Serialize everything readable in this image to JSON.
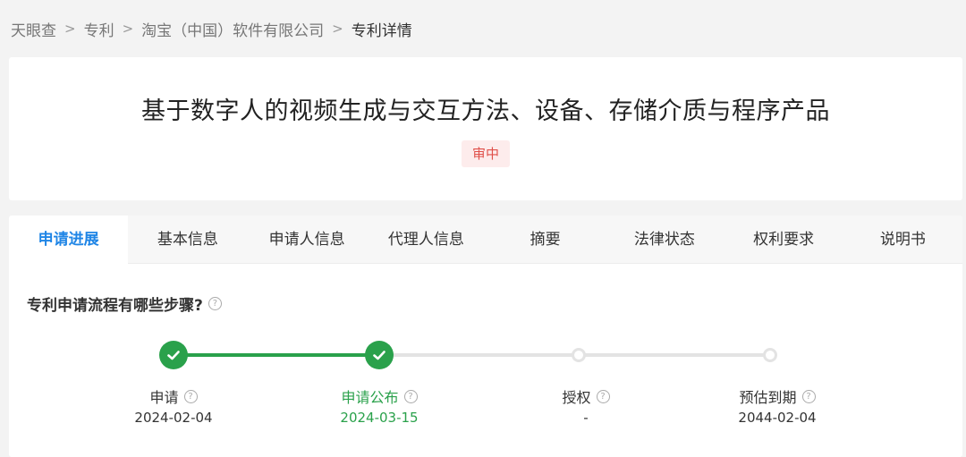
{
  "breadcrumb": {
    "items": [
      "天眼查",
      "专利",
      "淘宝（中国）软件有限公司",
      "专利详情"
    ],
    "separator": ">"
  },
  "patent": {
    "title": "基于数字人的视频生成与交互方法、设备、存储介质与程序产品",
    "status": "审中"
  },
  "tabs": [
    "申请进展",
    "基本信息",
    "申请人信息",
    "代理人信息",
    "摘要",
    "法律状态",
    "权利要求",
    "说明书"
  ],
  "active_tab": "申请进展",
  "progress": {
    "heading": "专利申请流程有哪些步骤?",
    "help_glyph": "?",
    "steps": [
      {
        "label": "申请",
        "date": "2024-02-04",
        "status": "done"
      },
      {
        "label": "申请公布",
        "date": "2024-03-15",
        "status": "done"
      },
      {
        "label": "授权",
        "date": "-",
        "status": "pending"
      },
      {
        "label": "预估到期",
        "date": "2044-02-04",
        "status": "pending"
      }
    ]
  },
  "colors": {
    "accent_blue": "#1f85e6",
    "done_green": "#2aa14b",
    "badge_bg": "#fdecec",
    "badge_text": "#e0504a"
  }
}
